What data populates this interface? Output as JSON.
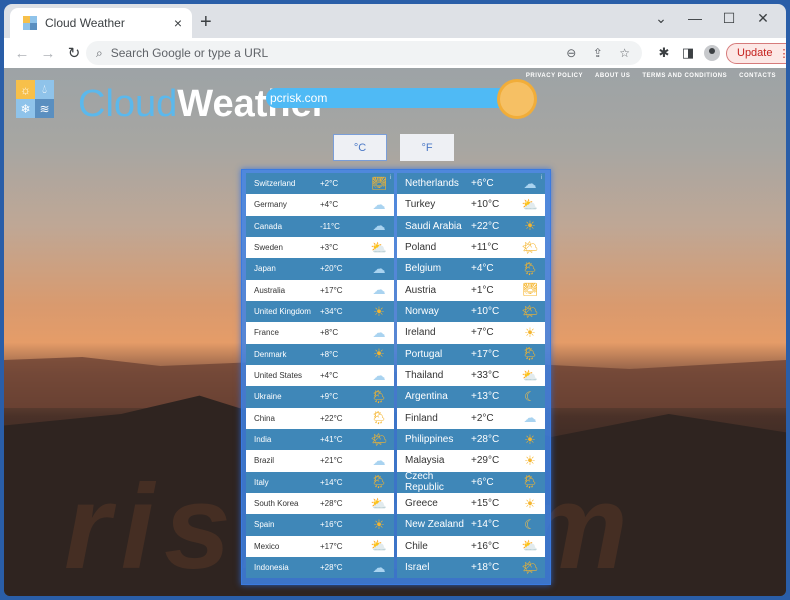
{
  "browser": {
    "tab_title": "Cloud Weather",
    "tab_close": "×",
    "new_tab": "+",
    "window_controls": [
      "⌄",
      "—",
      "☐",
      "✕"
    ],
    "address_placeholder": "Search Google or type a URL",
    "update_label": "Update",
    "nav": {
      "back": "←",
      "forward": "→",
      "reload": "↻"
    },
    "icons": {
      "search": "🔍︎",
      "zoom": "⊖",
      "share": "⇪",
      "star": "☆",
      "extensions": "✱",
      "sidepanel": "◨",
      "menu": "⋮"
    }
  },
  "site": {
    "brand_cloud": "Cloud",
    "brand_weather": "Weather",
    "search_value": "pcrisk.com",
    "logo_icons": [
      "☼",
      "💧︎",
      "❄",
      "≋"
    ],
    "nav_links": [
      "PRIVACY POLICY",
      "ABOUT US",
      "TERMS AND CONDITIONS",
      "CONTACTS"
    ],
    "units": {
      "celsius": "°C",
      "fahrenheit": "°F",
      "active": "celsius"
    },
    "watermark": "risk.com",
    "info_marker": "i"
  },
  "weather": {
    "left": [
      {
        "country": "Switzerland",
        "temp": "+2°C",
        "icon": "sunset"
      },
      {
        "country": "Germany",
        "temp": "+4°C",
        "icon": "cloud"
      },
      {
        "country": "Canada",
        "temp": "-11°C",
        "icon": "cloud"
      },
      {
        "country": "Sweden",
        "temp": "+3°C",
        "icon": "partly-cloudy"
      },
      {
        "country": "Japan",
        "temp": "+20°C",
        "icon": "cloud"
      },
      {
        "country": "Australia",
        "temp": "+17°C",
        "icon": "cloud"
      },
      {
        "country": "United Kingdom",
        "temp": "+34°C",
        "icon": "sun"
      },
      {
        "country": "France",
        "temp": "+8°C",
        "icon": "cloud"
      },
      {
        "country": "Denmark",
        "temp": "+8°C",
        "icon": "sun"
      },
      {
        "country": "United States",
        "temp": "+4°C",
        "icon": "cloud"
      },
      {
        "country": "Ukraine",
        "temp": "+9°C",
        "icon": "sun-rain"
      },
      {
        "country": "China",
        "temp": "+22°C",
        "icon": "sun-rain"
      },
      {
        "country": "India",
        "temp": "+41°C",
        "icon": "sun-cloud"
      },
      {
        "country": "Brazil",
        "temp": "+21°C",
        "icon": "cloud"
      },
      {
        "country": "Italy",
        "temp": "+14°C",
        "icon": "sun-rain"
      },
      {
        "country": "South Korea",
        "temp": "+28°C",
        "icon": "partly-cloudy"
      },
      {
        "country": "Spain",
        "temp": "+16°C",
        "icon": "sun"
      },
      {
        "country": "Mexico",
        "temp": "+17°C",
        "icon": "partly-cloudy"
      },
      {
        "country": "Indonesia",
        "temp": "+28°C",
        "icon": "cloud"
      }
    ],
    "right": [
      {
        "country": "Netherlands",
        "temp": "+6°C",
        "icon": "cloud"
      },
      {
        "country": "Turkey",
        "temp": "+10°C",
        "icon": "partly-cloudy"
      },
      {
        "country": "Saudi Arabia",
        "temp": "+22°C",
        "icon": "sun"
      },
      {
        "country": "Poland",
        "temp": "+11°C",
        "icon": "sun-cloud"
      },
      {
        "country": "Belgium",
        "temp": "+4°C",
        "icon": "sun-rain"
      },
      {
        "country": "Austria",
        "temp": "+1°C",
        "icon": "sunset"
      },
      {
        "country": "Norway",
        "temp": "+10°C",
        "icon": "sun-cloud"
      },
      {
        "country": "Ireland",
        "temp": "+7°C",
        "icon": "sun"
      },
      {
        "country": "Portugal",
        "temp": "+17°C",
        "icon": "sun-rain"
      },
      {
        "country": "Thailand",
        "temp": "+33°C",
        "icon": "partly-cloudy"
      },
      {
        "country": "Argentina",
        "temp": "+13°C",
        "icon": "moon"
      },
      {
        "country": "Finland",
        "temp": "+2°C",
        "icon": "cloud"
      },
      {
        "country": "Philippines",
        "temp": "+28°C",
        "icon": "sun"
      },
      {
        "country": "Malaysia",
        "temp": "+29°C",
        "icon": "sun"
      },
      {
        "country": "Czech Republic",
        "temp": "+6°C",
        "icon": "sun-rain"
      },
      {
        "country": "Greece",
        "temp": "+15°C",
        "icon": "sun"
      },
      {
        "country": "New Zealand",
        "temp": "+14°C",
        "icon": "moon-rain"
      },
      {
        "country": "Chile",
        "temp": "+16°C",
        "icon": "partly-cloudy"
      },
      {
        "country": "Israel",
        "temp": "+18°C",
        "icon": "sun-cloud"
      }
    ],
    "icon_glyphs": {
      "sun": "☀",
      "cloud": "☁",
      "partly-cloudy": "⛅",
      "sun-cloud": "🌤︎",
      "sun-rain": "🌦︎",
      "sunset": "🌅︎",
      "moon": "☾",
      "moon-rain": "☾"
    }
  }
}
